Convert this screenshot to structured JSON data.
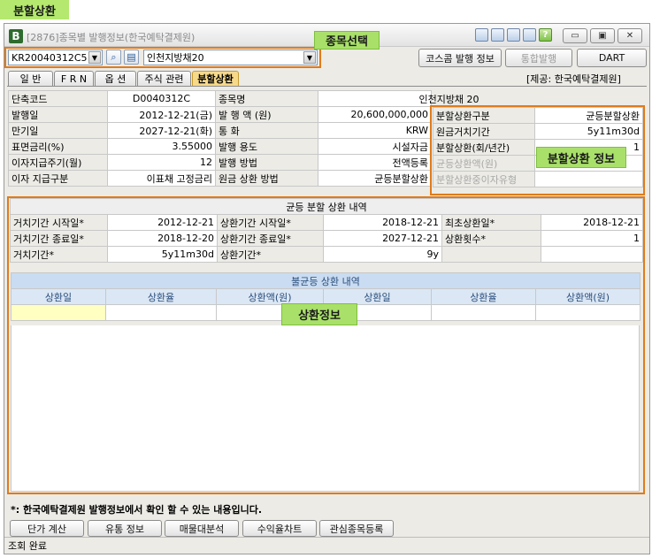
{
  "page_heading": "분할상환",
  "window": {
    "title": "[2876]종목별 발행정보(한국예탁결제원)",
    "icons": [
      "window-layout-icon",
      "window-copy-icon",
      "window-link-icon",
      "print-icon",
      "help-icon"
    ],
    "help_glyph": "?",
    "controls": {
      "minimize": "▭",
      "restore": "▣",
      "close": "✕"
    }
  },
  "annotations": {
    "stock_select": "종목선택",
    "split_info": "분할상환 정보",
    "repayment_info": "상환정보"
  },
  "search": {
    "code": "KR20040312C5",
    "name": "인천지방채20",
    "dropdown_glyph": "▼"
  },
  "toolbar": {
    "kosscom_label": "코스콤 발행 정보",
    "integrated_label": "통합발행",
    "dart_label": "DART"
  },
  "tabs": [
    {
      "label": "일 반",
      "active": false
    },
    {
      "label": "F R N",
      "active": false
    },
    {
      "label": "옵 션",
      "active": false
    },
    {
      "label": "주식 관련",
      "active": false
    },
    {
      "label": "분할상환",
      "active": true
    }
  ],
  "provider_note": "[제공: 한국예탁결제원]",
  "info": {
    "rows": [
      [
        "단축코드",
        "D0040312C",
        "종목명",
        "인천지방채 20"
      ],
      [
        "발행일",
        "2012-12-21(금)",
        "발 행 액 (원)",
        "20,600,000,000"
      ],
      [
        "만기일",
        "2027-12-21(화)",
        "통 화",
        "KRW"
      ],
      [
        "표면금리(%)",
        "3.55000",
        "발행 용도",
        "시설자금"
      ],
      [
        "이자지급주기(월)",
        "12",
        "발행 방법",
        "전액등록"
      ],
      [
        "이자 지급구분",
        "이표채 고정금리",
        "원금 상환 방법",
        "균등분할상환"
      ]
    ],
    "split": [
      {
        "label": "분할상환구분",
        "value": "균등분할상환",
        "dim": false
      },
      {
        "label": "원금거치기간",
        "value": "5y11m30d",
        "dim": false
      },
      {
        "label": "분할상환(회/년간)",
        "value": "1",
        "dim": false
      },
      {
        "label": "균등상환액(원)",
        "value": "",
        "dim": true
      },
      {
        "label": "분할상환중이자유형",
        "value": "",
        "dim": true
      }
    ]
  },
  "equal": {
    "title": "균등 분할 상환 내역",
    "rows": [
      [
        "거치기간 시작일*",
        "2012-12-21",
        "상환기간 시작일*",
        "2018-12-21",
        "최초상환일*",
        "2018-12-21"
      ],
      [
        "거치기간 종료일*",
        "2018-12-20",
        "상환기간 종료일*",
        "2027-12-21",
        "상환횟수*",
        "1"
      ],
      [
        "거치기간*",
        "5y11m30d",
        "상환기간*",
        "9y",
        "",
        ""
      ]
    ]
  },
  "unequal": {
    "title": "불균등 상환 내역",
    "columns": [
      "상환일",
      "상환율",
      "상환액(원)",
      "상환일",
      "상환율",
      "상환액(원)"
    ]
  },
  "footnote": "*: 한국예탁결제원 발행정보에서 확인 할 수 있는 내용입니다.",
  "bottom_buttons": [
    "단가 계산",
    "유통 정보",
    "매물대분석",
    "수익율차트",
    "관심종목등록"
  ],
  "status": "조회 완료"
}
